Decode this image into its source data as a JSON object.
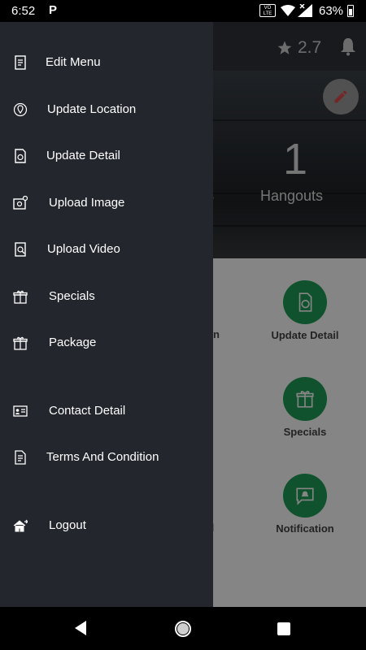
{
  "status_bar": {
    "time": "6:52",
    "p_label": "P",
    "volte_top": "VO",
    "volte_bottom": "LTE",
    "battery": "63%"
  },
  "app": {
    "rating": "2.7",
    "hangouts_count": "1",
    "hangouts_label": "Hangouts",
    "hero_partial_text": "s",
    "grid": [
      {
        "label": "Update Detail",
        "icon": "update-detail-icon"
      },
      {
        "label": "Specials",
        "icon": "gift-icon"
      },
      {
        "label": "Notification",
        "icon": "notification-icon"
      }
    ],
    "partial_left": [
      "on",
      "il"
    ],
    "accent_color": "#1e9e57"
  },
  "drawer": {
    "background": "#23262d",
    "items": [
      {
        "label": "Edit Menu",
        "icon": "menu-book-icon"
      },
      {
        "label": "Update Location",
        "icon": "location-pin-icon"
      },
      {
        "label": "Update Detail",
        "icon": "update-detail-icon"
      },
      {
        "label": "Upload Image",
        "icon": "upload-image-icon"
      },
      {
        "label": "Upload Video",
        "icon": "upload-video-icon"
      },
      {
        "label": "Specials",
        "icon": "gift-icon"
      },
      {
        "label": "Package",
        "icon": "package-gift-icon"
      },
      {
        "label": "Contact Detail",
        "icon": "contact-card-icon"
      },
      {
        "label": "Terms And Condition",
        "icon": "terms-document-icon"
      },
      {
        "label": "Logout",
        "icon": "logout-home-icon"
      }
    ]
  },
  "nav_bar": {
    "back": "back-icon",
    "home": "home-icon",
    "recents": "recents-icon"
  }
}
